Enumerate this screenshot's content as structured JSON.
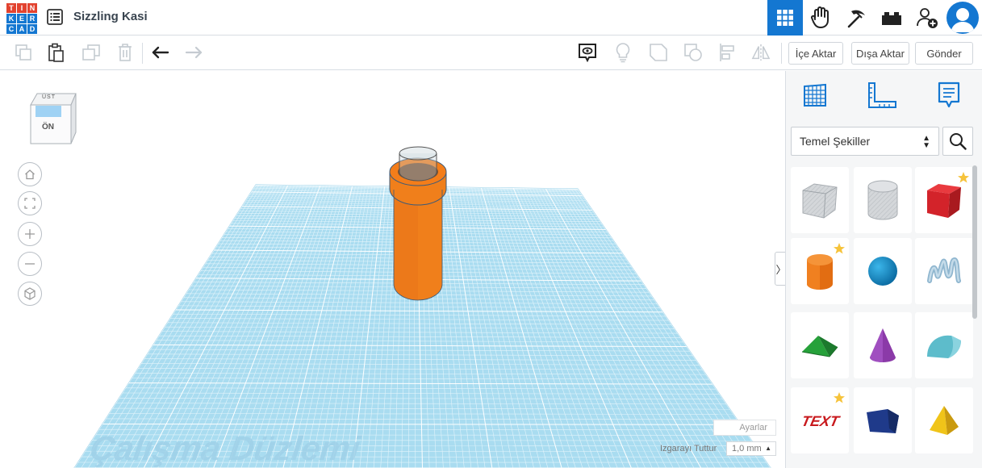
{
  "app": {
    "logo_letters": [
      "T",
      "I",
      "N",
      "K",
      "E",
      "R",
      "C",
      "A",
      "D"
    ],
    "design_name": "Sizzling Kasi",
    "accent_color": "#1477d1"
  },
  "topbar": {
    "buttons": [
      "grid-view-icon",
      "tinker-hand-icon",
      "pickaxe-icon",
      "bricks-icon",
      "add-user-icon",
      "avatar"
    ]
  },
  "toolbar": {
    "icons": [
      "copy-icon",
      "paste-icon",
      "duplicate-icon",
      "delete-icon",
      "undo-icon",
      "redo-icon",
      "notes-icon",
      "light-bulb-icon",
      "shape-outline-icon",
      "group-icon",
      "align-icon",
      "mirror-icon"
    ],
    "import_label": "İçe Aktar",
    "export_label": "Dışa Aktar",
    "send_label": "Gönder"
  },
  "viewcube": {
    "top_label": "ÜST",
    "front_label": "ÖN"
  },
  "workplane": {
    "label": "Çalışma Düzlemi",
    "settings_label": "Ayarlar",
    "snap_label": "Izgarayı Tuttur",
    "snap_value": "1,0 mm"
  },
  "panel": {
    "category": "Temel Şekiller",
    "toggle_glyph": "〉",
    "shapes": [
      "box-hole",
      "cylinder-hole",
      "box",
      "cylinder",
      "sphere",
      "scribble",
      "roof",
      "cone",
      "round-roof",
      "text",
      "polygon",
      "pyramid"
    ],
    "text_shape_label": "TEXT"
  }
}
